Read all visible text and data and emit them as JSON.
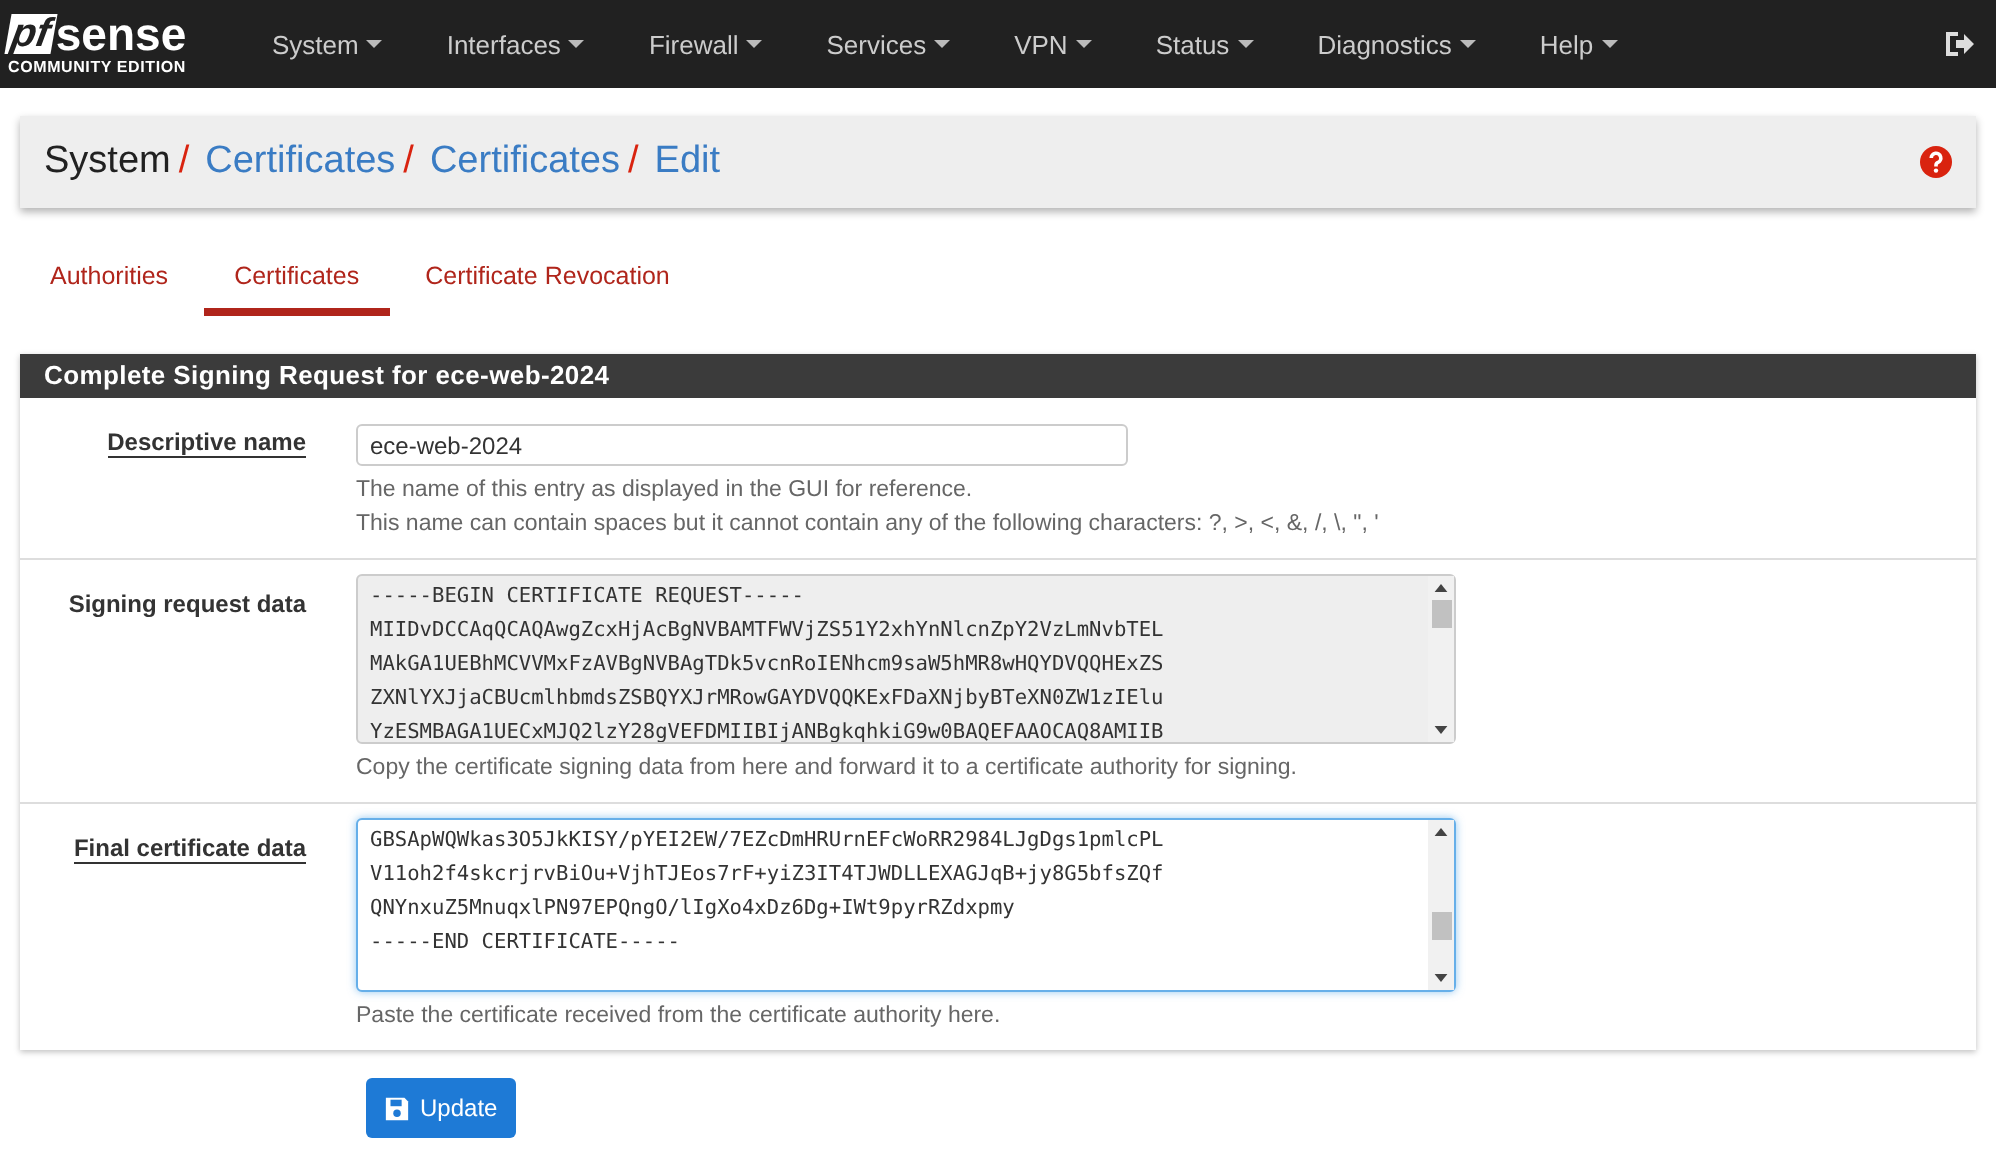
{
  "logo": {
    "mark": "pf",
    "word": "sense",
    "edition": "COMMUNITY EDITION"
  },
  "nav": {
    "items": [
      {
        "label": "System"
      },
      {
        "label": "Interfaces"
      },
      {
        "label": "Firewall"
      },
      {
        "label": "Services"
      },
      {
        "label": "VPN"
      },
      {
        "label": "Status"
      },
      {
        "label": "Diagnostics"
      },
      {
        "label": "Help"
      }
    ]
  },
  "breadcrumb": [
    {
      "label": "System",
      "link": false,
      "separator": "/"
    },
    {
      "label": "Certificates",
      "link": true,
      "separator": "/"
    },
    {
      "label": "Certificates",
      "link": true,
      "separator": "/"
    },
    {
      "label": "Edit",
      "link": true
    }
  ],
  "tabs": [
    {
      "label": "Authorities",
      "selected": false
    },
    {
      "label": "Certificates",
      "selected": true
    },
    {
      "label": "Certificate Revocation",
      "selected": false
    }
  ],
  "panel": {
    "title": "Complete Signing Request for ece-web-2024",
    "rows": [
      {
        "kind": "input",
        "label": "Descriptive name",
        "underlined": true,
        "value": "ece-web-2024",
        "help": [
          "The name of this entry as displayed in the GUI for reference.",
          "This name can contain spaces but it cannot contain any of the following characters: ?, >, <, &, /, \\, \", '"
        ]
      },
      {
        "kind": "textarea",
        "label": "Signing request data",
        "underlined": false,
        "readonly": true,
        "focused": false,
        "lines": [
          "-----BEGIN CERTIFICATE REQUEST-----",
          "MIIDvDCCAqQCAQAwgZcxHjAcBgNVBAMTFWVjZS51Y2xhYnNlcnZpY2VzLmNvbTEL",
          "MAkGA1UEBhMCVVMxFzAVBgNVBAgTDk5vcnRoIENhcm9saW5hMR8wHQYDVQQHExZS",
          "ZXNlYXJjaCBUcmlhbmdsZSBQYXJrMRowGAYDVQQKExFDaXNjbyBTeXN0ZW1zIElu",
          "YzESMBAGA1UECxMJQ2lzY28gVEFDMIIBIjANBgkqhkiG9w0BAQEFAAOCAQ8AMIIB"
        ],
        "help": [
          "Copy the certificate signing data from here and forward it to a certificate authority for signing."
        ]
      },
      {
        "kind": "textarea",
        "label": "Final certificate data",
        "underlined": true,
        "readonly": false,
        "focused": true,
        "lines": [
          "GBSApWQWkas3O5JkKISY/pYEI2EW/7EZcDmHRUrnEFcWoRR2984LJgDgs1pmlcPL",
          "V11oh2f4skcrjrvBiOu+VjhTJEos7rF+yiZ3IT4TJWDLLEXAGJqB+jy8G5bfsZQf",
          "QNYnxuZ5MnuqxlPN97EPQngO/lIgXo4xDz6Dg+IWt9pyrRZdxpmy",
          "-----END CERTIFICATE-----"
        ],
        "help": [
          "Paste the certificate received from the certificate authority here."
        ]
      }
    ]
  },
  "button": {
    "label": "Update"
  }
}
